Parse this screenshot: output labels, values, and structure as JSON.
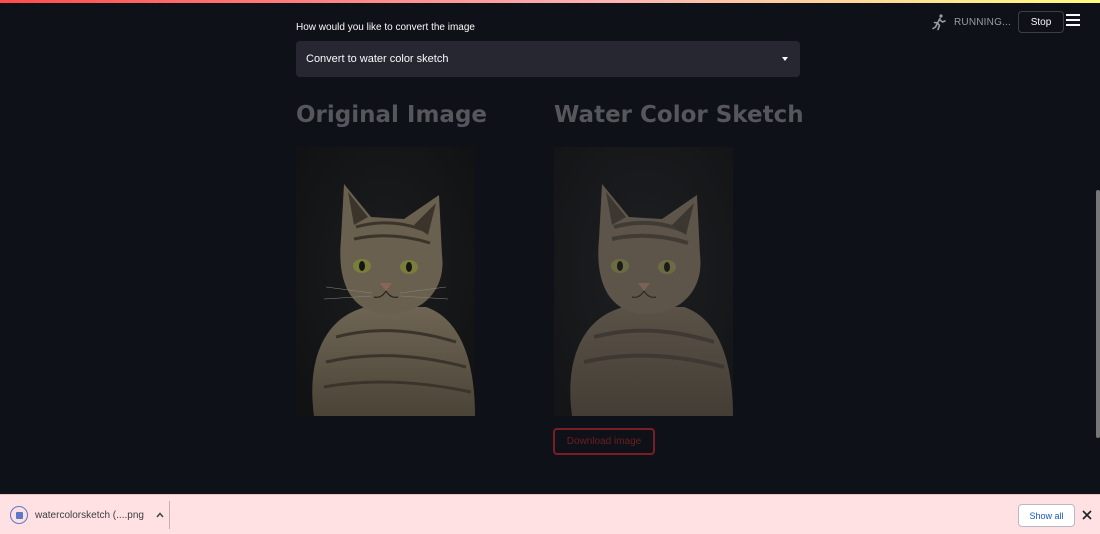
{
  "header": {
    "status_text": "RUNNING...",
    "stop_label": "Stop"
  },
  "main": {
    "select_label": "How would you like to convert the image",
    "select_value": "Convert to water color sketch",
    "left_heading": "Original Image",
    "right_heading": "Water Color Sketch",
    "download_label": "Download image"
  },
  "shelf": {
    "file_name": "watercolorsketch (....png",
    "show_all_label": "Show all"
  },
  "colors": {
    "background": "#0e1117",
    "select_bg": "#262730",
    "heading": "#55575c",
    "download_border": "#7a1d24",
    "shelf_bg": "#ffe0e3",
    "link_blue": "#1a56c4"
  },
  "icons": {
    "status": "running-person-icon",
    "menu": "hamburger-menu-icon",
    "select_caret": "caret-down-icon",
    "file": "file-icon",
    "chevron": "chevron-up-icon",
    "close": "close-icon"
  }
}
